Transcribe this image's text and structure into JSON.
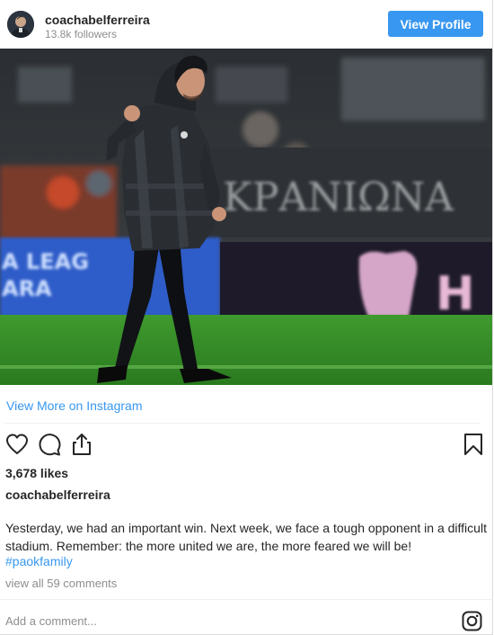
{
  "header": {
    "username": "coachabelferreira",
    "followers": "13.8k followers",
    "view_profile_label": "View Profile"
  },
  "post": {
    "image_stadium_text": "ΚΡΑΝΙΩΝΑ",
    "image_board_text_line1": "A LEAG",
    "image_board_text_line2": "ARA",
    "image_board_right_text": "H",
    "view_more_label": "View More on Instagram",
    "likes": "3,678 likes",
    "caption_username": "coachabelferreira",
    "caption_text": "Yesterday, we had an important win. Next week, we face a tough opponent in a difficult stadium. Remember: the more united we are, the more feared we will be!",
    "hashtag": "#paokfamily",
    "view_comments": "view all 59 comments",
    "add_comment_placeholder": "Add a comment..."
  },
  "icons": {
    "like": "heart-icon",
    "comment": "comment-icon",
    "share": "share-icon",
    "save": "bookmark-icon",
    "instagram": "instagram-icon"
  },
  "colors": {
    "accent": "#3897f0",
    "text": "#262626",
    "muted": "#8e8e8e",
    "pitch": "#2f8a24"
  }
}
